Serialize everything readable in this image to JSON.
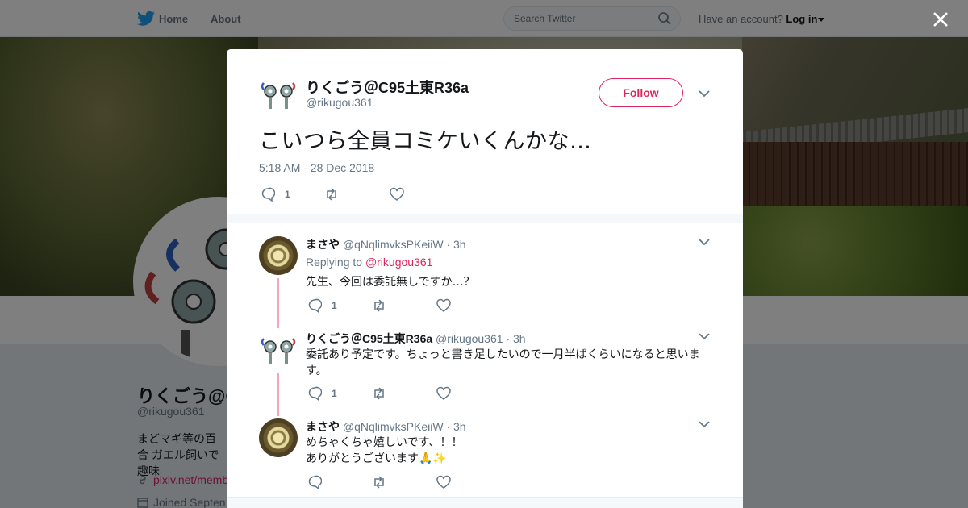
{
  "nav": {
    "home": "Home",
    "about": "About",
    "search_placeholder": "Search Twitter",
    "have_account": "Have an account?",
    "login": "Log in"
  },
  "profile": {
    "name": "りくごう@C",
    "handle": "@rikugou361",
    "bio": "まどマギ等の百合 ガエル飼いで趣味",
    "link": "pixiv.net/memb",
    "joined": "Joined Septen"
  },
  "tweet": {
    "name": "りくごう＠C95土東R36a",
    "handle": "@rikugou361",
    "follow": "Follow",
    "text": "こいつら全員コミケいくんかな…",
    "timestamp": "5:18 AM - 28 Dec 2018",
    "reply_count": "1"
  },
  "replies": [
    {
      "name": "まさや",
      "handle": "@qNqlimvksPKeiiW",
      "time": "· 3h",
      "replying_label": "Replying to",
      "replying_to": "@rikugou361",
      "text": "先生、今回は委託無しですか…？",
      "reply_count": "1"
    },
    {
      "name": "りくごう＠C95土東R36a",
      "handle": "@rikugou361",
      "time": "· 3h",
      "text": "委託あり予定です。ちょっと書き足したいので一月半ばくらいになると思います。",
      "reply_count": "1"
    },
    {
      "name": "まさや",
      "handle": "@qNqlimvksPKeiiW",
      "time": "· 3h",
      "text_line1": "めちゃくちゃ嬉しいです、！！",
      "text_line2": "ありがとうございます🙏✨"
    }
  ],
  "colors": {
    "accent": "#e0245e",
    "thread_line": "#f4a7bb",
    "twitter_blue": "#1da1f2"
  }
}
